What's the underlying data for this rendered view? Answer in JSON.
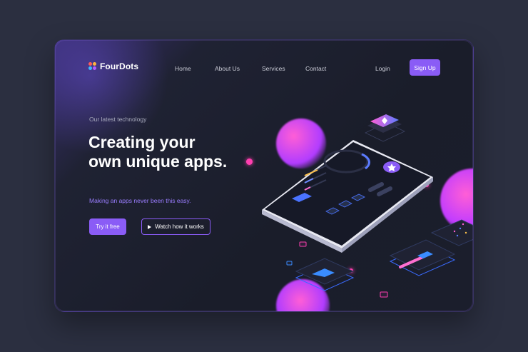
{
  "brand": {
    "name": "FourDots",
    "colors": {
      "accent": "#8a5cf6",
      "background": "#2b2f40",
      "card": "#1c1f2c",
      "highlight": "#9a7dff",
      "orb": "#ff5ed6"
    }
  },
  "nav": {
    "items": [
      {
        "label": "Home"
      },
      {
        "label": "About Us"
      },
      {
        "label": "Services"
      },
      {
        "label": "Contact"
      }
    ],
    "login_label": "Login",
    "signup_label": "Sign Up"
  },
  "hero": {
    "eyebrow": "Our latest technology",
    "headline": "Creating your own unique apps.",
    "subtitle": "Making an apps never been this easy.",
    "primary_cta": "Try it free",
    "secondary_cta": "Watch how it works"
  },
  "illustration": {
    "icons": [
      "compass-icon",
      "star-icon",
      "cart-icon",
      "crown-icon",
      "mail-icon",
      "chat-icon",
      "rocket-icon"
    ]
  }
}
